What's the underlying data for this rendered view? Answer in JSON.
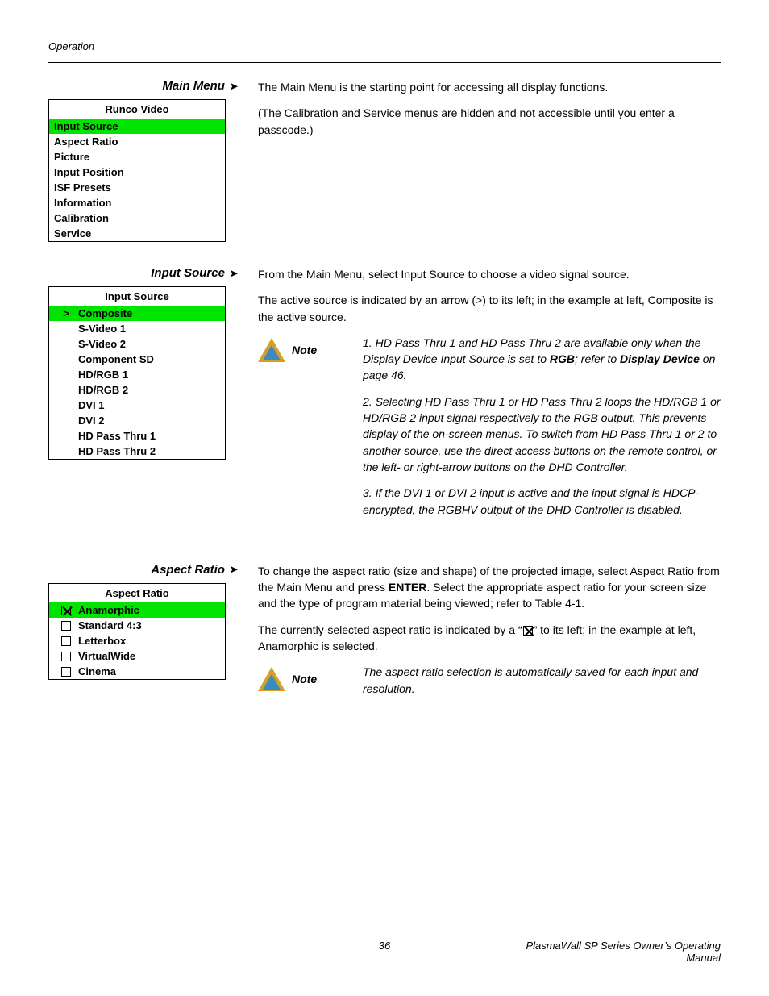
{
  "header": {
    "section": "Operation"
  },
  "main_menu": {
    "heading": "Main Menu",
    "para1": "The Main Menu is the starting point for accessing all display functions.",
    "para2": "(The Calibration and Service menus are hidden and not accessible until you enter a passcode.)",
    "menu_title": "Runco Video",
    "items": [
      "Input Source",
      "Aspect Ratio",
      "Picture",
      "Input Position",
      "ISF Presets",
      "Information",
      "Calibration",
      "Service"
    ]
  },
  "input_source": {
    "heading": "Input Source",
    "para1": "From the Main Menu, select Input Source to choose a video signal source.",
    "para2": "The active source is indicated by an arrow (>) to its left; in the example at left, Composite is the active source.",
    "menu_title": "Input Source",
    "items": [
      "Composite",
      "S-Video 1",
      "S-Video 2",
      "Component SD",
      "HD/RGB 1",
      "HD/RGB 2",
      "DVI 1",
      "DVI 2",
      "HD Pass Thru 1",
      "HD Pass Thru 2"
    ],
    "active_marker": ">",
    "note_label": "Note",
    "note1_pre": "HD Pass Thru 1 and HD Pass Thru 2 are available only when the Display Device Input Source is set to ",
    "note1_rgb": "RGB",
    "note1_mid": "; refer to ",
    "note1_dd": "Display Device",
    "note1_post": " on page 46.",
    "note2": "Selecting HD Pass Thru 1 or HD Pass Thru 2 loops the HD/RGB 1 or HD/RGB 2 input signal respectively to the RGB output. This prevents display of the on-screen menus. To switch from HD Pass Thru 1 or 2 to another source, use the direct access buttons on the remote control, or the left- or right-arrow buttons on the DHD Controller.",
    "note3": "If the DVI 1 or DVI 2 input is active and the input signal is HDCP-encrypted, the RGBHV output of the DHD Controller is disabled."
  },
  "aspect_ratio": {
    "heading": "Aspect Ratio",
    "para1_pre": "To change the aspect ratio (size and shape) of the projected image, select Aspect Ratio from the Main Menu and press ",
    "para1_enter": "ENTER",
    "para1_post": ". Select the appropriate aspect ratio for your screen size and the type of program material being viewed; refer to Table 4-1.",
    "para2_pre": "The currently-selected aspect ratio is indicated by a “",
    "para2_post": "” to its left; in the example at left, Anamorphic is selected.",
    "menu_title": "Aspect Ratio",
    "items": [
      "Anamorphic",
      "Standard 4:3",
      "Letterbox",
      "VirtualWide",
      "Cinema"
    ],
    "note_label": "Note",
    "note_text": "The aspect ratio selection is automatically saved for each input and resolution."
  },
  "footer": {
    "page": "36",
    "manual": "PlasmaWall SP Series Owner’s Operating Manual"
  }
}
